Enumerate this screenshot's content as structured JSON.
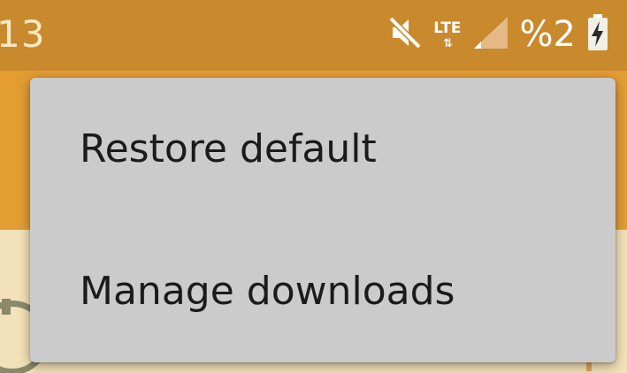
{
  "status_bar": {
    "time": "13",
    "network_type": "LTE",
    "network_arrows": "⇅",
    "battery_percent": "%2",
    "icons": [
      "mute-icon",
      "signal-icon",
      "battery-charging-icon"
    ]
  },
  "popup_menu": {
    "items": [
      {
        "label": "Restore default"
      },
      {
        "label": "Manage downloads"
      }
    ]
  },
  "colors": {
    "status_bar": "#c9892d",
    "toolbar": "#e39d33",
    "menu_bg": "#cbcbcb",
    "menu_text": "#1b1b1b"
  }
}
